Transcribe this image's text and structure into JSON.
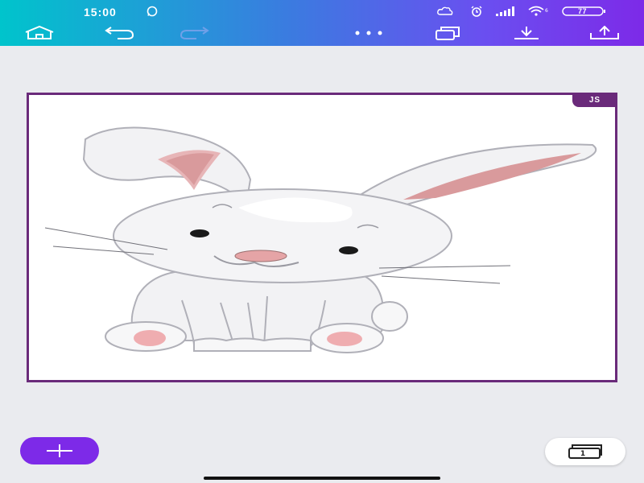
{
  "status_bar": {
    "time": "15:00",
    "battery": "77",
    "icons": [
      "whatsapp-icon",
      "cloud-icon",
      "alarm-icon",
      "signal-icon",
      "wifi-icon",
      "battery-icon"
    ]
  },
  "toolbar": {
    "buttons": [
      "home-icon",
      "undo-icon",
      "redo-icon",
      "more-icon",
      "copy-icon",
      "download-icon",
      "share-icon"
    ]
  },
  "canvas": {
    "badge": "JS"
  },
  "bottom": {
    "page_count": "1"
  },
  "colors": {
    "accent": "#7d2ae8",
    "gradient_start": "#00c4cc",
    "frame": "#6a2a7a",
    "background": "#eaebef"
  }
}
